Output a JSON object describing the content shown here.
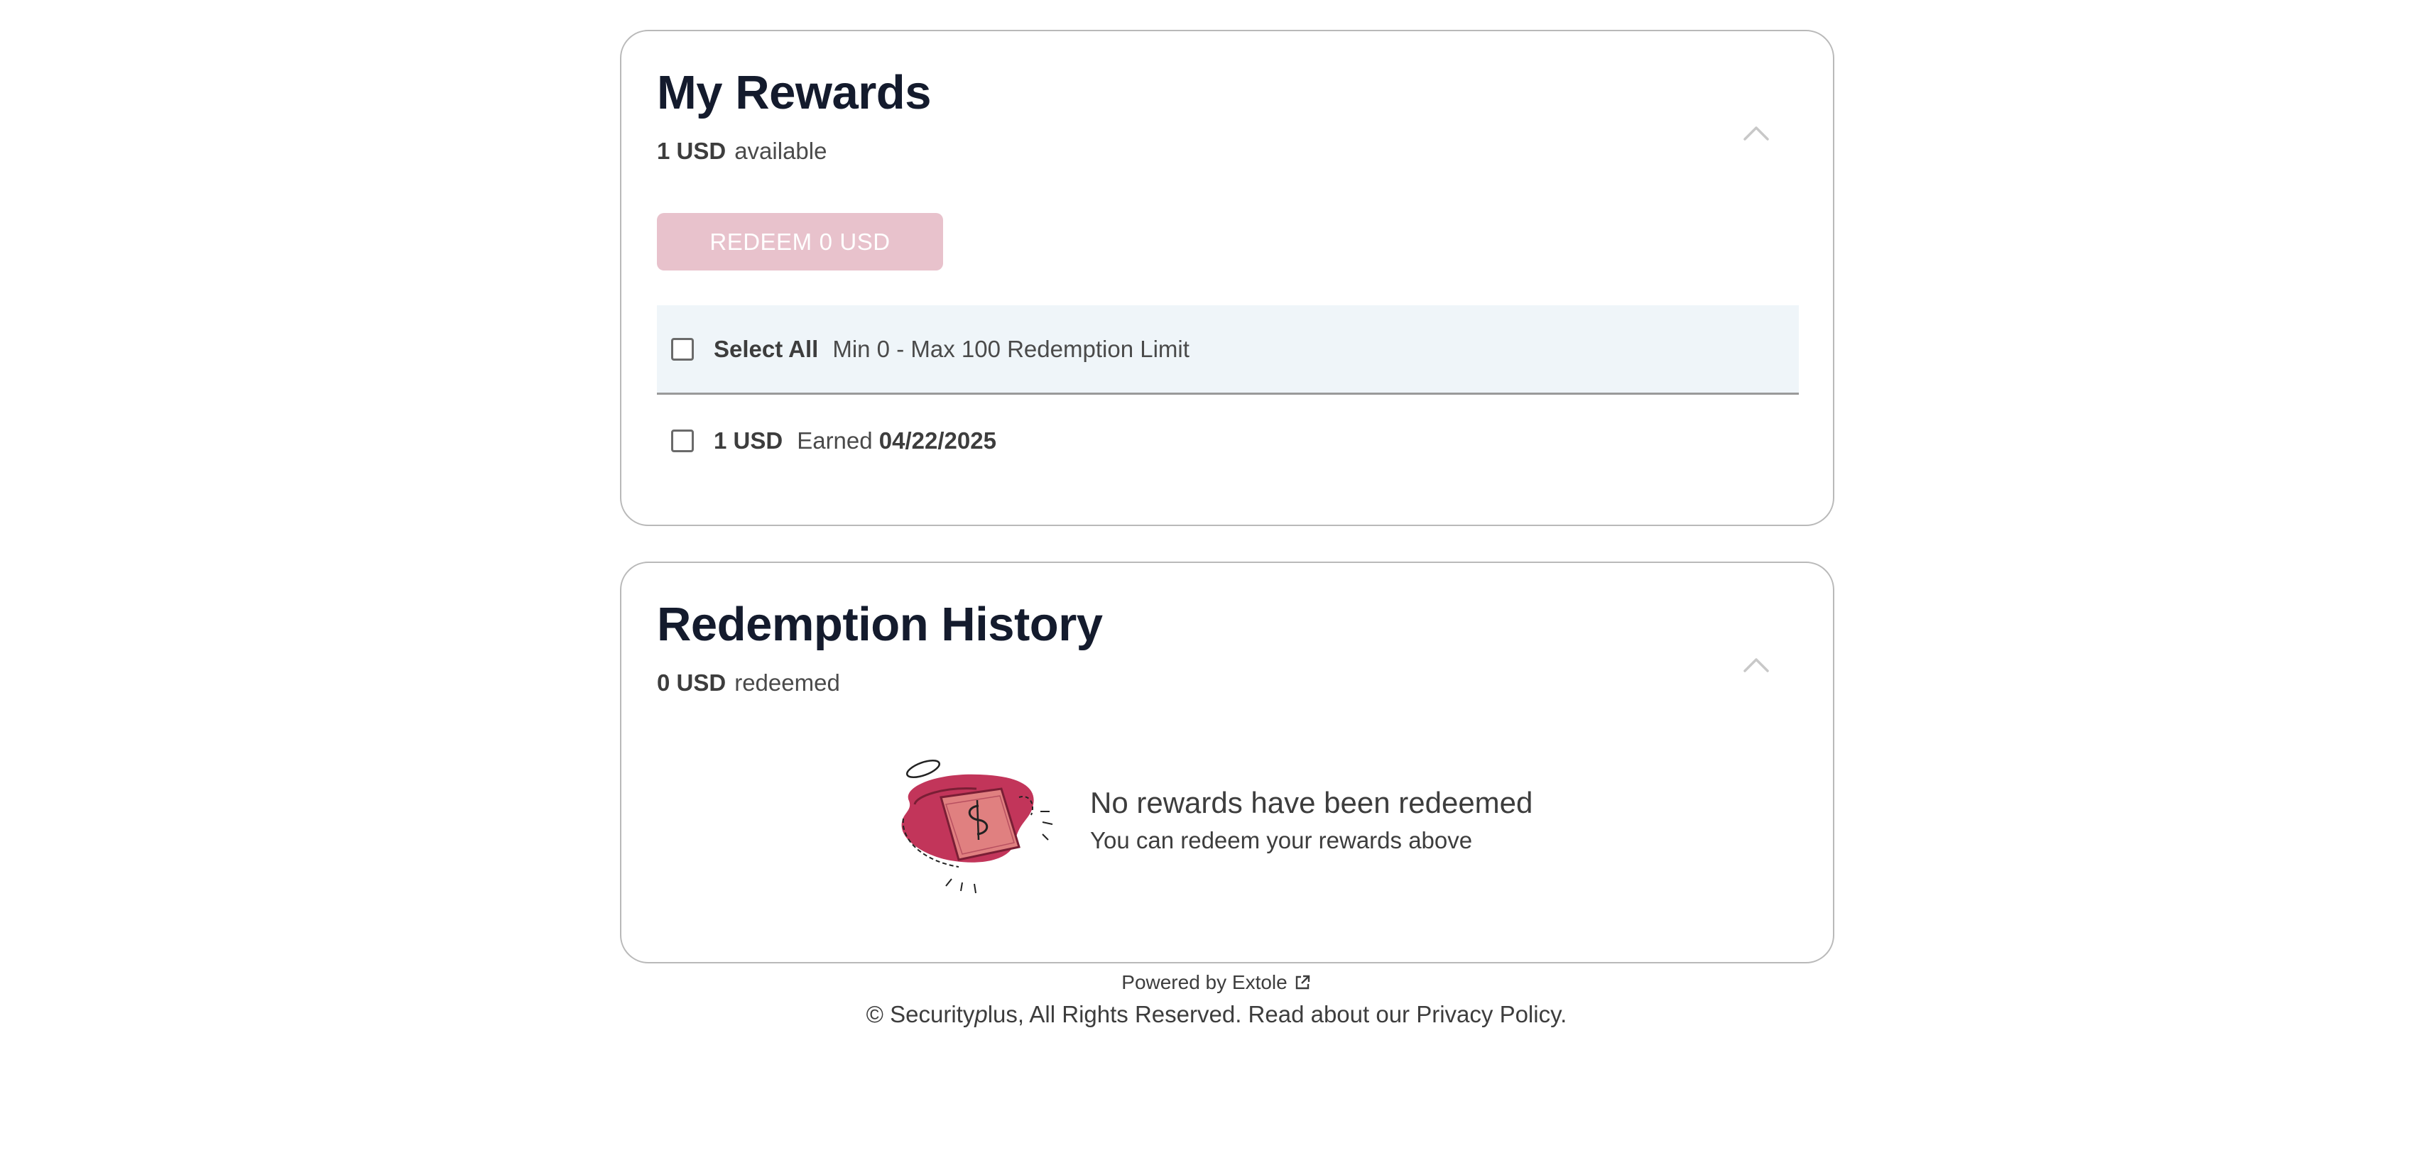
{
  "rewards": {
    "title": "My Rewards",
    "available_amount": "1 USD",
    "available_label": "available",
    "redeem_button": {
      "prefix": "REDEEM",
      "amount": "0",
      "currency": "USD"
    },
    "select_all_label": "Select All",
    "limit_text": "Min 0 - Max 100 Redemption Limit",
    "items": [
      {
        "amount": "1 USD",
        "earned_label": "Earned",
        "date": "04/22/2025"
      }
    ],
    "collapse_icon": "chevron-up-icon"
  },
  "history": {
    "title": "Redemption History",
    "redeemed_amount": "0 USD",
    "redeemed_label": "redeemed",
    "empty_title": "No rewards have been redeemed",
    "empty_subtitle": "You can redeem your rewards above",
    "collapse_icon": "chevron-up-icon",
    "illustration_icon": "wallet-dollar-illustration"
  },
  "footer": {
    "powered_by": "Powered by Extole",
    "copyright_prefix": "© Security",
    "copyright_brand_italic": "p",
    "copyright_suffix": "lus, All Rights Reserved. Read about our ",
    "privacy_link": "Privacy Policy."
  },
  "colors": {
    "title": "#141b2d",
    "redeem_button_disabled": "#e8c2cc",
    "select_row_bg": "#eff5f9",
    "card_border": "#b9b9b9",
    "illustration_red": "#c2355a",
    "illustration_pink": "#e08080"
  }
}
